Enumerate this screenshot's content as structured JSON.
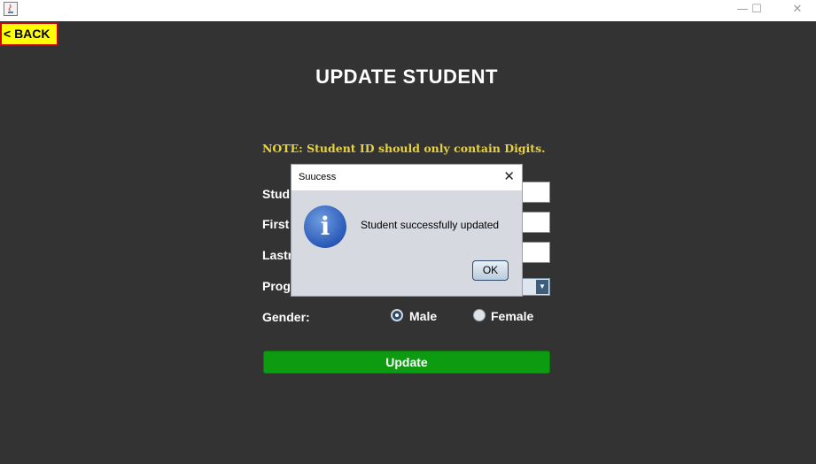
{
  "window": {
    "controls": {
      "minimize": "—",
      "maximize": "☐",
      "close": "✕"
    }
  },
  "toolbar": {
    "back_label": "<  BACK"
  },
  "page": {
    "title": "UPDATE STUDENT",
    "note": "NOTE: Student ID should only contain Digits."
  },
  "form": {
    "labels": {
      "student_id": "Stud",
      "first_name": "First",
      "last_name": "Lastr",
      "program": "Prog",
      "gender": "Gender:"
    },
    "gender": {
      "options": [
        "Male",
        "Female"
      ],
      "selected": "Male"
    },
    "update_label": "Update"
  },
  "dialog": {
    "title": "Suucess",
    "message": "Student successfully updated",
    "ok_label": "OK",
    "icon": "info-icon"
  },
  "colors": {
    "background": "#333333",
    "back_button": "#ffff00",
    "back_border": "#d00000",
    "note_text": "#e8d33a",
    "update_button": "#0d9b11"
  }
}
